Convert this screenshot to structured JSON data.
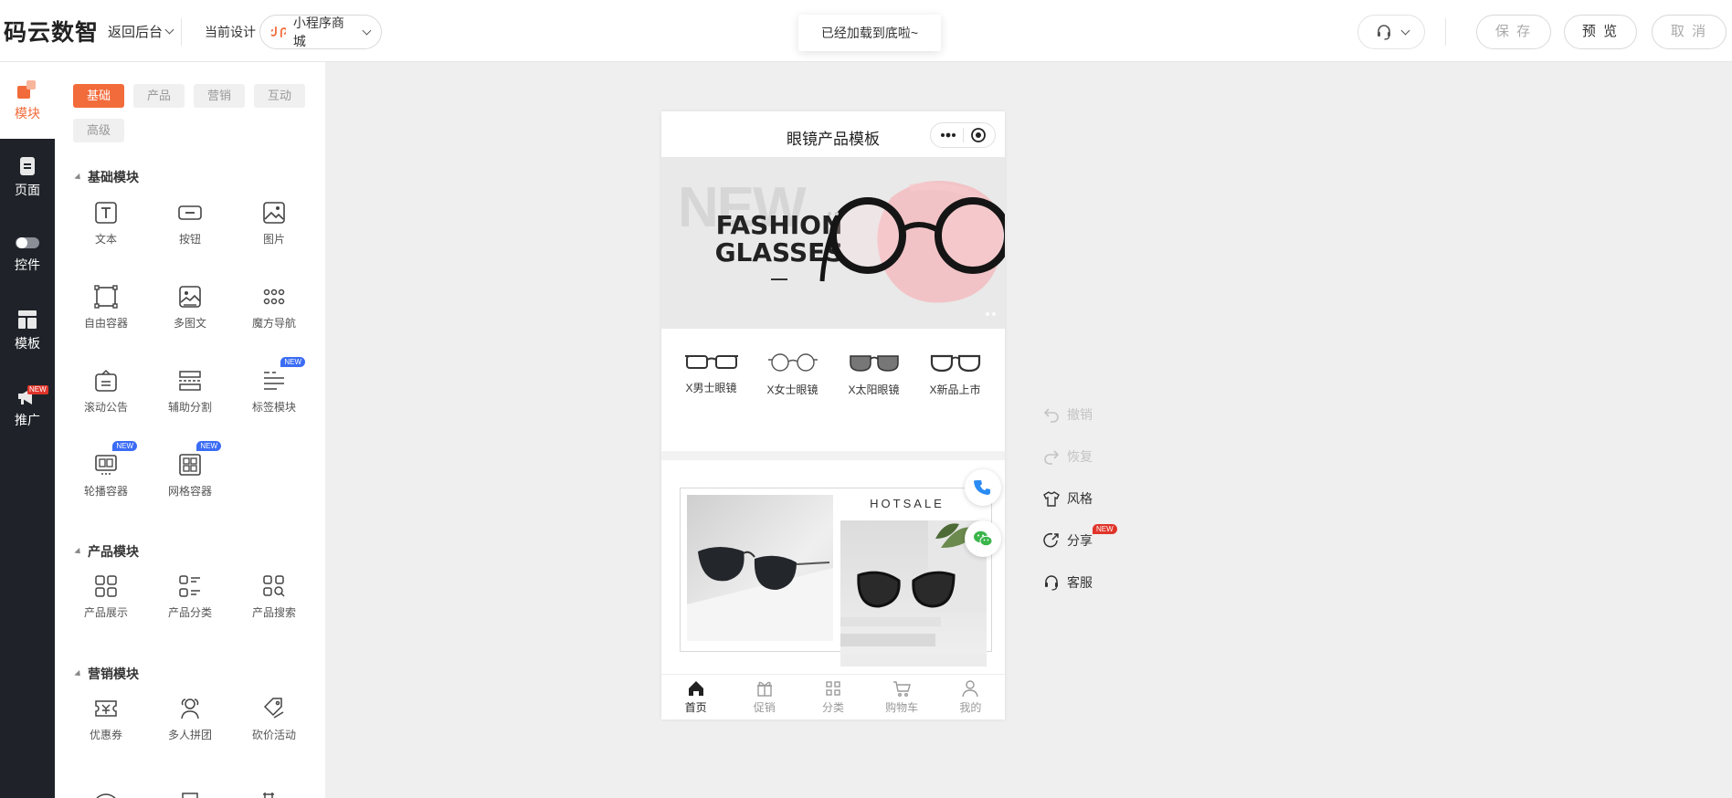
{
  "topbar": {
    "brand": "码云数智",
    "back": "返回后台",
    "current_design_label": "当前设计",
    "mini_program": "小程序商城",
    "toast": "已经加载到底啦~",
    "save": "保 存",
    "preview": "预 览",
    "cancel": "取 消"
  },
  "leftnav": {
    "items": [
      {
        "label": "模块",
        "icon": "module-icon",
        "active": true
      },
      {
        "label": "页面",
        "icon": "page-icon"
      },
      {
        "label": "控件",
        "icon": "toggle-icon"
      },
      {
        "label": "模板",
        "icon": "template-icon"
      },
      {
        "label": "推广",
        "icon": "megaphone-icon",
        "badge": "NEW"
      }
    ]
  },
  "panel": {
    "tabs": [
      "基础",
      "产品",
      "营销",
      "互动",
      "高级"
    ],
    "active_tab": "基础",
    "sections": [
      {
        "title": "基础模块",
        "items": [
          {
            "label": "文本",
            "icon": "text-icon"
          },
          {
            "label": "按钮",
            "icon": "button-icon"
          },
          {
            "label": "图片",
            "icon": "image-icon"
          },
          {
            "label": "自由容器",
            "icon": "free-container-icon"
          },
          {
            "label": "多图文",
            "icon": "multi-image-icon"
          },
          {
            "label": "魔方导航",
            "icon": "grid-dots-icon"
          },
          {
            "label": "滚动公告",
            "icon": "notice-icon"
          },
          {
            "label": "辅助分割",
            "icon": "divider-icon"
          },
          {
            "label": "标签模块",
            "icon": "tag-list-icon",
            "badge": "NEW"
          },
          {
            "label": "轮播容器",
            "icon": "carousel-icon",
            "badge": "NEW"
          },
          {
            "label": "网格容器",
            "icon": "grid-container-icon",
            "badge": "NEW"
          }
        ]
      },
      {
        "title": "产品模块",
        "items": [
          {
            "label": "产品展示",
            "icon": "product-grid-icon"
          },
          {
            "label": "产品分类",
            "icon": "product-category-icon"
          },
          {
            "label": "产品搜索",
            "icon": "product-search-icon"
          }
        ]
      },
      {
        "title": "营销模块",
        "items": [
          {
            "label": "优惠券",
            "icon": "coupon-icon"
          },
          {
            "label": "多人拼团",
            "icon": "group-buy-icon"
          },
          {
            "label": "砍价活动",
            "icon": "bargain-icon"
          }
        ]
      }
    ]
  },
  "phone": {
    "title": "眼镜产品模板",
    "banner": {
      "bg_word": "NEW",
      "line1": "FASHION",
      "line2": "GLASSES"
    },
    "categories": [
      "X男士眼镜",
      "X女士眼镜",
      "X太阳眼镜",
      "X新品上市"
    ],
    "hotsale": "HOTSALE",
    "tabbar": [
      "首页",
      "促销",
      "分类",
      "购物车",
      "我的"
    ],
    "active_tab": "首页"
  },
  "actions": [
    {
      "label": "撤销",
      "icon": "undo-icon",
      "disabled": true
    },
    {
      "label": "恢复",
      "icon": "redo-icon",
      "disabled": true
    },
    {
      "label": "风格",
      "icon": "shirt-icon"
    },
    {
      "label": "分享",
      "icon": "share-icon",
      "badge": "NEW"
    },
    {
      "label": "客服",
      "icon": "headset-icon"
    }
  ],
  "colors": {
    "accent": "#f26b3a",
    "dark_nav": "#1f2329",
    "new_badge_blue": "#3b6cf5",
    "new_badge_red": "#e0352b",
    "canvas_bg": "#efefef"
  }
}
